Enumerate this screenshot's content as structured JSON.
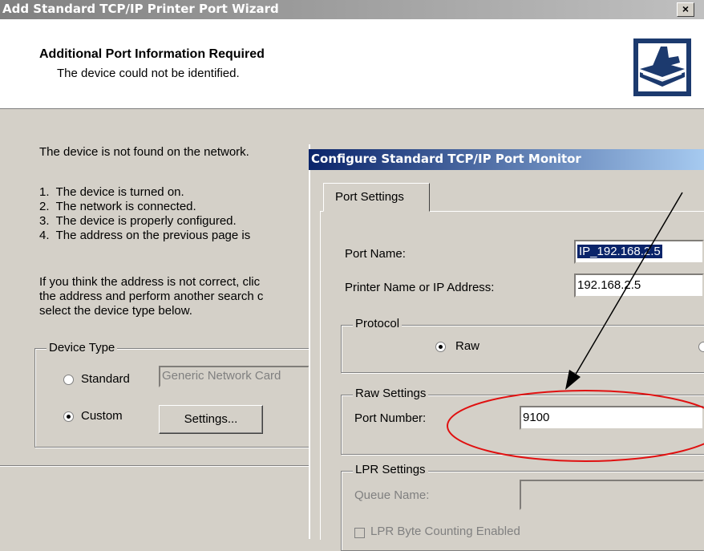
{
  "window": {
    "title": "Add Standard TCP/IP Printer Port Wizard",
    "close_glyph": "×"
  },
  "header": {
    "title": "Additional Port Information Required",
    "subtitle": "The device could not be identified.",
    "icon": "printer-wizard-icon"
  },
  "main": {
    "intro": "The device is not found on the network.",
    "list": [
      "1.  The device is turned on.",
      "2.  The network is connected.",
      "3.  The device is properly configured.",
      "4.  The address on the previous page is"
    ],
    "paragraph": [
      "If you think the address is not correct, clic",
      "the address and perform another search c",
      "select the device type below."
    ],
    "device_type": {
      "legend": "Device Type",
      "standard_label": "Standard",
      "standard_value": "Generic Network Card",
      "custom_label": "Custom",
      "settings_button": "Settings..."
    }
  },
  "dialog": {
    "title": "Configure Standard TCP/IP Port Monitor",
    "tab": "Port Settings",
    "port_name_label": "Port Name:",
    "port_name_value": "IP_192.168.2.5",
    "printer_label": "Printer Name or IP Address:",
    "printer_value": "192.168.2.5",
    "protocol_legend": "Protocol",
    "raw_label": "Raw",
    "raw_settings_legend": "Raw Settings",
    "port_number_label": "Port Number:",
    "port_number_value": "9100",
    "lpr_legend": "LPR Settings",
    "queue_label": "Queue Name:",
    "lpr_byte_label": "LPR Byte Counting Enabled"
  },
  "annotation_colors": {
    "ellipse": "#e01010",
    "arrow": "#000000"
  }
}
